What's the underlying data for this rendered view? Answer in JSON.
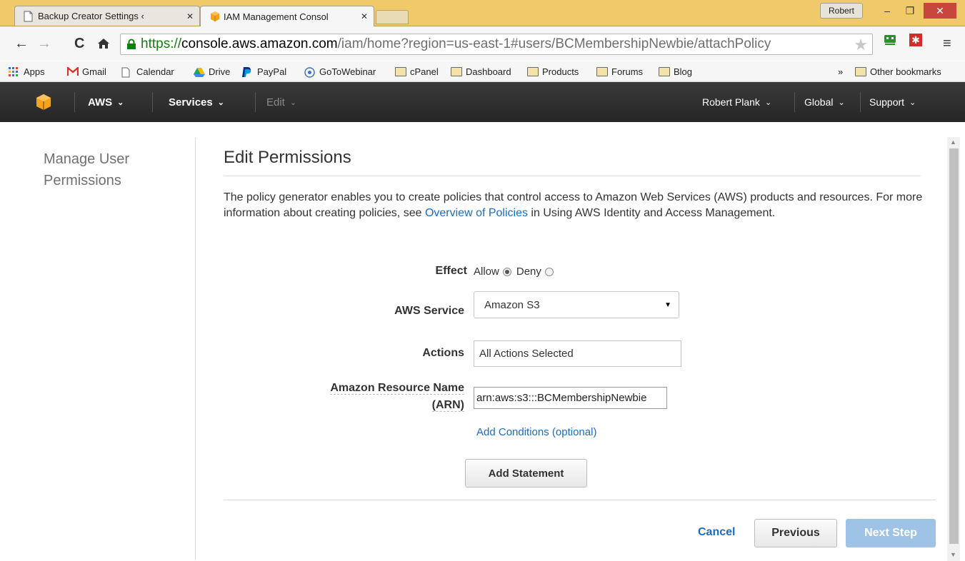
{
  "browser": {
    "tabs": [
      {
        "title": "Backup Creator Settings ‹",
        "active": false
      },
      {
        "title": "IAM Management Consol",
        "active": true
      }
    ],
    "profile_name": "Robert",
    "url": {
      "scheme": "https://",
      "host": "console.aws.amazon.com",
      "path": "/iam/home?region=us-east-1#users/BCMembershipNewbie/attachPolicy"
    },
    "bookmarks": [
      "Apps",
      "Gmail",
      "Calendar",
      "Drive",
      "PayPal",
      "GoToWebinar",
      "cPanel",
      "Dashboard",
      "Products",
      "Forums",
      "Blog"
    ],
    "bookmarks_overflow": "»",
    "other_bookmarks": "Other bookmarks"
  },
  "aws_nav": {
    "aws": "AWS",
    "services": "Services",
    "edit": "Edit",
    "user": "Robert Plank",
    "region": "Global",
    "support": "Support"
  },
  "sidebar": {
    "title": "Manage User Permissions"
  },
  "main": {
    "title": "Edit Permissions",
    "intro_before_link": "The policy generator enables you to create policies that control access to Amazon Web Services (AWS) products and resources. For more information about creating policies, see ",
    "intro_link": "Overview of Policies",
    "intro_after_link": " in Using AWS Identity and Access Management.",
    "effect": {
      "label": "Effect",
      "options": [
        "Allow",
        "Deny"
      ],
      "selected": "Allow"
    },
    "aws_service": {
      "label": "AWS Service",
      "value": "Amazon S3"
    },
    "actions": {
      "label": "Actions",
      "value": "All Actions Selected"
    },
    "arn": {
      "label_line1": "Amazon Resource Name",
      "label_line2": "(ARN)",
      "value": "arn:aws:s3:::BCMembershipNewbie"
    },
    "add_conditions": "Add Conditions (optional)",
    "add_statement": "Add Statement",
    "cancel": "Cancel",
    "previous": "Previous",
    "next_step": "Next Step"
  }
}
